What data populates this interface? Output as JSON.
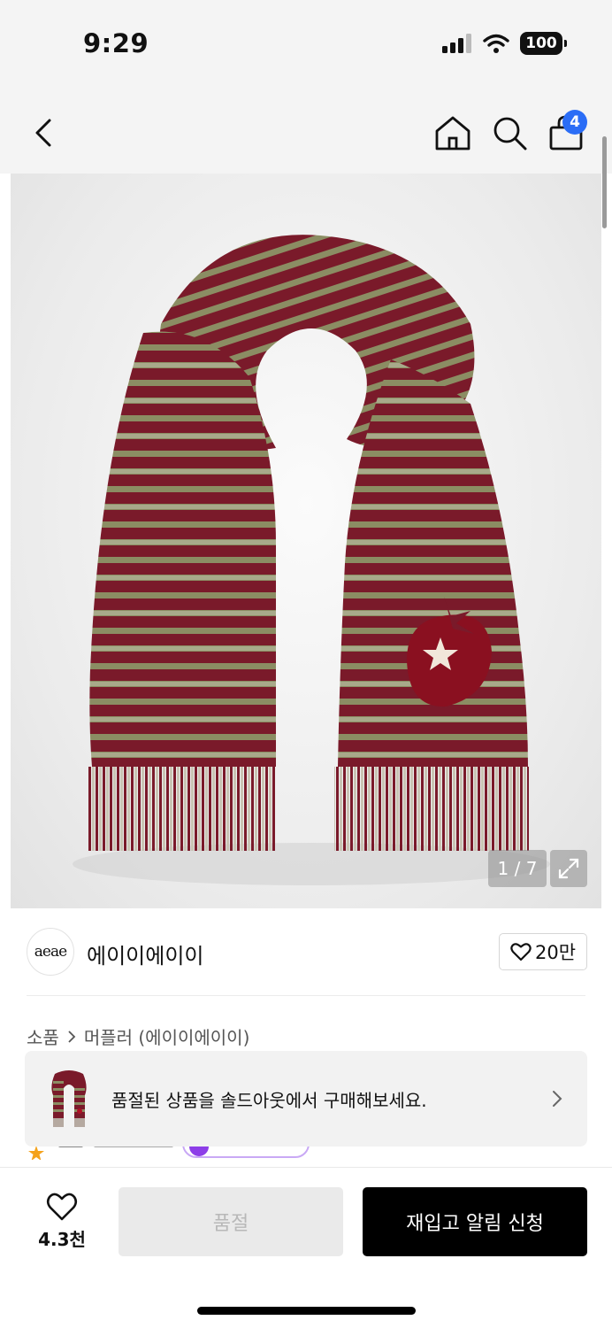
{
  "status_bar": {
    "time": "9:29",
    "battery": "100",
    "icons": [
      "cellular-signal-icon",
      "wifi-icon",
      "battery-icon"
    ]
  },
  "nav": {
    "icons": [
      "back-chevron-icon",
      "home-icon",
      "search-icon",
      "shopping-bag-icon"
    ],
    "cart_badge": "4",
    "badge_color": "#2b6df6"
  },
  "product_image": {
    "counter": "1 / 7",
    "expand_icon": "expand-icon",
    "stripe_colors": [
      "#7a1a2a",
      "#8b8d63"
    ]
  },
  "brand": {
    "logo_text": "aeae",
    "name": "에이이에이이",
    "like_count": "20만"
  },
  "breadcrumb": {
    "items": [
      "소품",
      "머플러 (에이이에이이)"
    ]
  },
  "banner": {
    "text": "품절된 상품을 솔드아웃에서 구매해보세요."
  },
  "bottom_bar": {
    "wish_count": "4.3천",
    "soldout_label": "품절",
    "restock_label": "재입고 알림 신청"
  }
}
